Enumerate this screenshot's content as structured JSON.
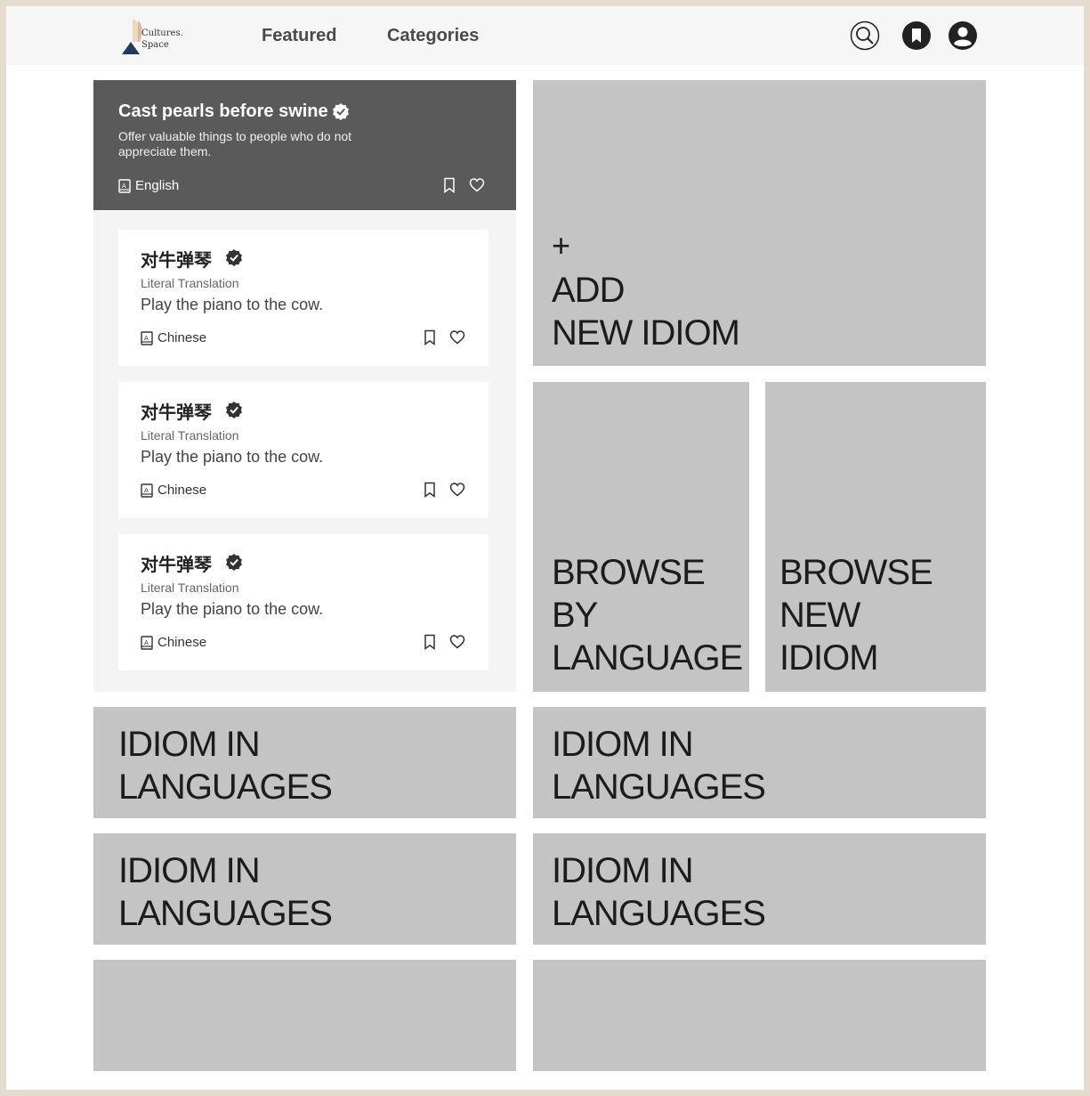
{
  "header": {
    "logo_text_line1": "Cultures.",
    "logo_text_line2": "Space",
    "nav": [
      {
        "label": "Featured"
      },
      {
        "label": "Categories"
      }
    ],
    "icons": [
      "search-icon",
      "bookmark-icon",
      "user-icon"
    ]
  },
  "featured": {
    "title": "Cast pearls before swine",
    "description": "Offer valuable things to people who do not appreciate them.",
    "language": "English"
  },
  "idioms": [
    {
      "title": "对牛弹琴",
      "sub_label": "Literal Translation",
      "literal": "Play the piano to the cow.",
      "language": "Chinese"
    },
    {
      "title": "对牛弹琴",
      "sub_label": "Literal Translation",
      "literal": "Play the piano to the cow.",
      "language": "Chinese"
    },
    {
      "title": "对牛弹琴",
      "sub_label": "Literal Translation",
      "literal": "Play the piano to the cow.",
      "language": "Chinese"
    }
  ],
  "tiles": {
    "add_plus": "+",
    "add_line1": "ADD",
    "add_line2": "NEW IDIOM",
    "browse_language": "BROWSE\nBY\nLANGUAGE",
    "browse_new": "BROWSE\nNEW\nIDIOM",
    "idiom_in_languages_1": "IDIOM IN\nLANGUAGES",
    "idiom_in_languages_2": "IDIOM IN\nLANGUAGES",
    "idiom_in_languages_3": "IDIOM IN\nLANGUAGES",
    "idiom_in_languages_4": "IDIOM IN\nLANGUAGES"
  },
  "colors": {
    "frame_border": "#e6dbcf",
    "featured_bg": "#5a5a5a",
    "tile_bg": "#c4c4c4",
    "header_bg": "#f6f6f6"
  }
}
